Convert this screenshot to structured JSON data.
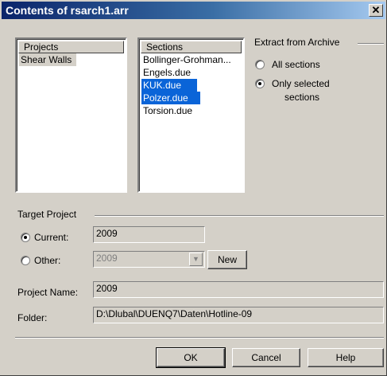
{
  "window": {
    "title": "Contents of rsarch1.arr",
    "close_glyph": "✕"
  },
  "projects": {
    "header": "Projects",
    "items": [
      {
        "label": "Shear Walls",
        "selected": true
      }
    ]
  },
  "sections": {
    "header": "Sections",
    "items": [
      {
        "label": "Bollinger-Grohman...",
        "selected": false
      },
      {
        "label": "Engels.due",
        "selected": false
      },
      {
        "label": "KUK.due",
        "selected": true
      },
      {
        "label": "Polzer.due",
        "selected": true
      },
      {
        "label": "Torsion.due",
        "selected": false
      }
    ]
  },
  "extract": {
    "group_label": "Extract from Archive",
    "all_sections": "All sections",
    "only_selected_line1": "Only selected",
    "only_selected_line2": "sections",
    "selected_option": "only_selected"
  },
  "target": {
    "group_label": "Target Project",
    "current_label": "Current:",
    "current_value": "2009",
    "other_label": "Other:",
    "other_value": "2009",
    "new_button": "New",
    "selected_option": "current"
  },
  "project_name": {
    "label": "Project Name:",
    "value": "2009"
  },
  "folder": {
    "label": "Folder:",
    "value": "D:\\Dlubal\\DUENQ7\\Daten\\Hotline-09"
  },
  "buttons": {
    "ok": "OK",
    "cancel": "Cancel",
    "help": "Help"
  },
  "icons": {
    "close": "close-icon",
    "dropdown": "chevron-down-icon"
  }
}
